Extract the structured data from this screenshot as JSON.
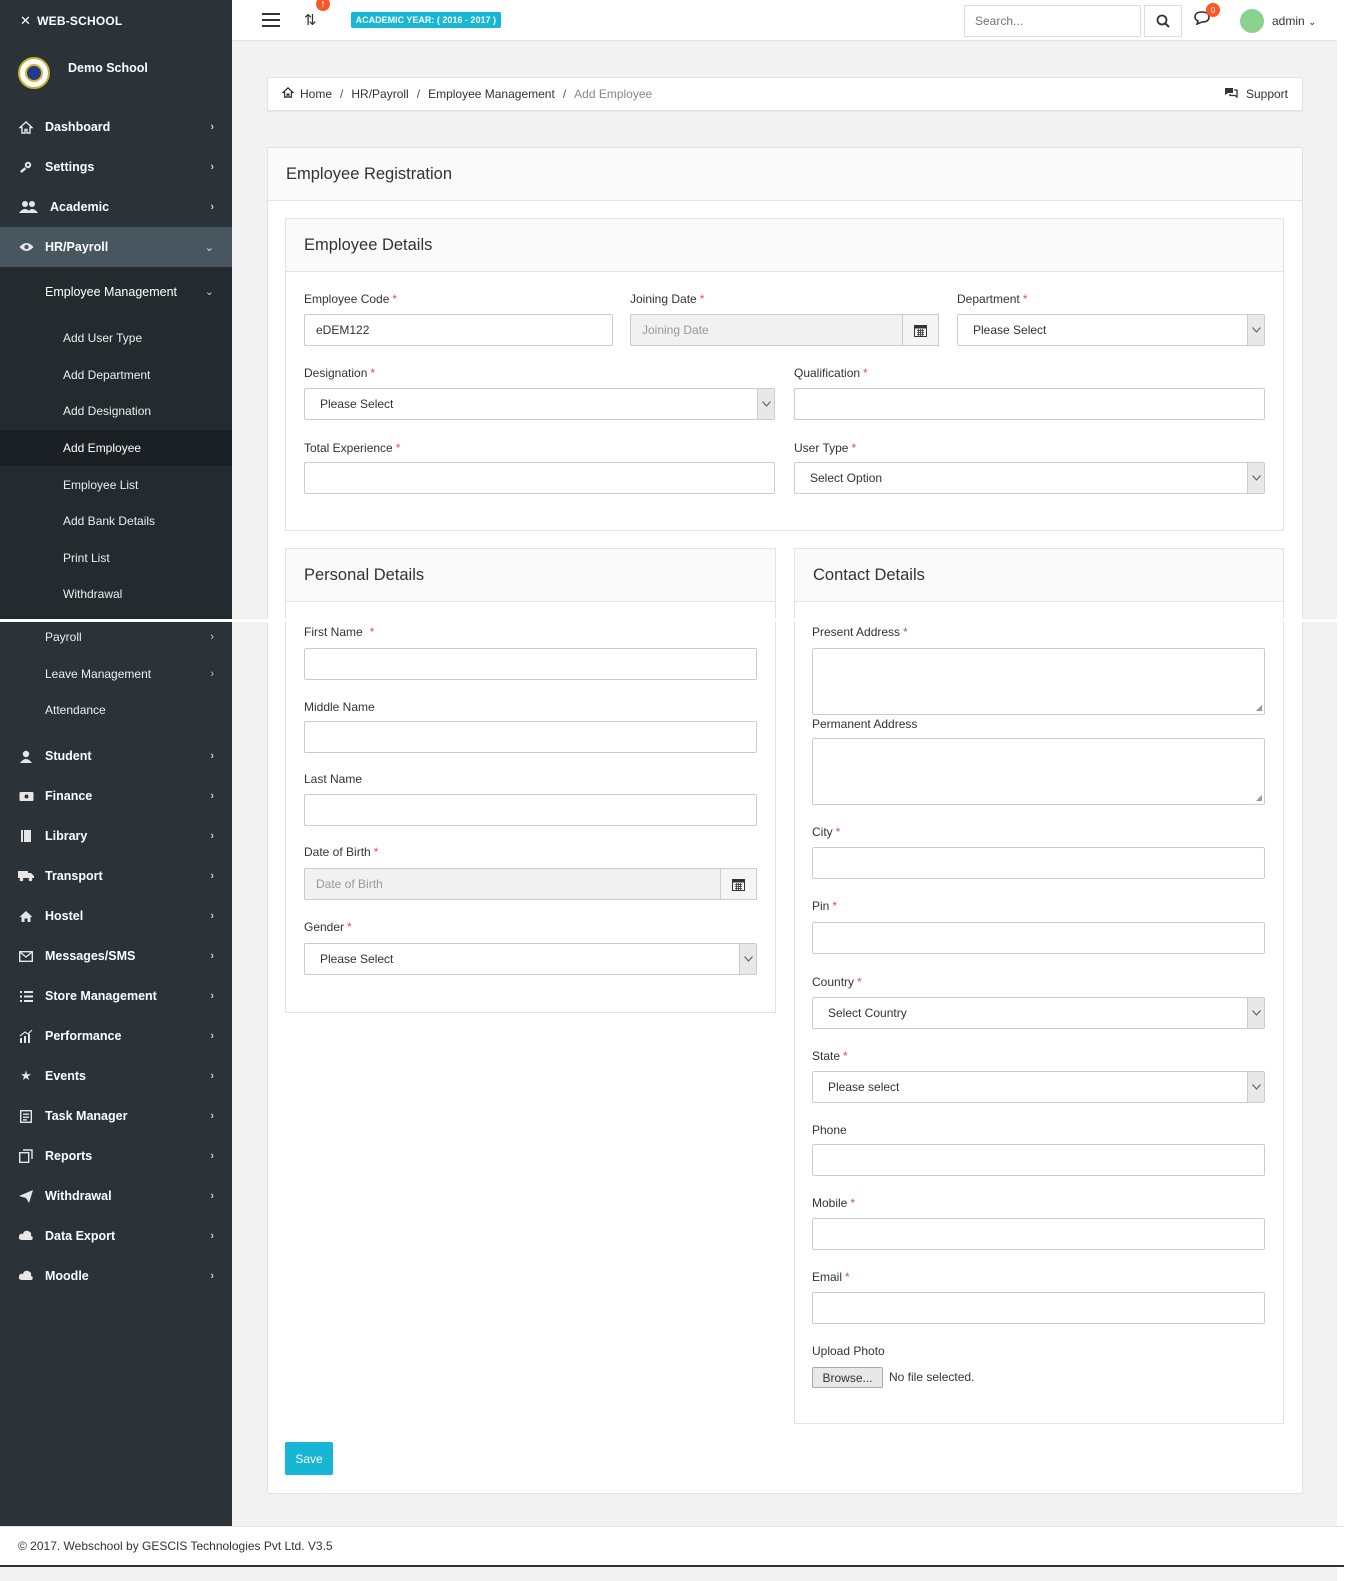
{
  "brand": "WEB-SCHOOL",
  "school_name": "Demo School",
  "sidebar": {
    "top_items": [
      {
        "label": "Dashboard",
        "icon": "home-icon"
      },
      {
        "label": "Settings",
        "icon": "settings-icon"
      },
      {
        "label": "Academic",
        "icon": "users-icon"
      },
      {
        "label": "HR/Payroll",
        "icon": "eye-icon"
      }
    ],
    "submenu_title": "Employee Management",
    "submenu_items": [
      "Add User Type",
      "Add Department",
      "Add Designation",
      "Add Employee",
      "Employee List",
      "Add Bank Details",
      "Print List",
      "Withdrawal"
    ],
    "hr_items": [
      "Payroll",
      "Leave Management",
      "Attendance"
    ],
    "bottom_items": [
      {
        "label": "Student",
        "icon": "user-icon"
      },
      {
        "label": "Finance",
        "icon": "bank-icon"
      },
      {
        "label": "Library",
        "icon": "book-icon"
      },
      {
        "label": "Transport",
        "icon": "truck-icon"
      },
      {
        "label": "Hostel",
        "icon": "home-icon"
      },
      {
        "label": "Messages/SMS",
        "icon": "envelope-icon"
      },
      {
        "label": "Store Management",
        "icon": "list-icon"
      },
      {
        "label": "Performance",
        "icon": "chart-icon"
      },
      {
        "label": "Events",
        "icon": "star-icon"
      },
      {
        "label": "Task Manager",
        "icon": "task-icon"
      },
      {
        "label": "Reports",
        "icon": "reports-icon"
      },
      {
        "label": "Withdrawal",
        "icon": "send-icon"
      },
      {
        "label": "Data Export",
        "icon": "cloud-icon"
      },
      {
        "label": "Moodle",
        "icon": "cloud-icon"
      }
    ]
  },
  "topbar": {
    "sync_badge": "!",
    "academic_year": "ACADEMIC YEAR: ( 2016 - 2017 )",
    "search_placeholder": "Search...",
    "chat_badge": "0",
    "user": "admin"
  },
  "breadcrumb": {
    "items": [
      "Home",
      "HR/Payroll",
      "Employee Management"
    ],
    "current": "Add Employee",
    "support": "Support"
  },
  "form": {
    "title": "Employee Registration",
    "employee_details": {
      "title": "Employee Details",
      "employee_code_label": "Employee Code",
      "employee_code_value": "eDEM122",
      "joining_date_label": "Joining Date",
      "joining_date_placeholder": "Joining Date",
      "department_label": "Department",
      "department_value": "Please Select",
      "designation_label": "Designation",
      "designation_value": "Please Select",
      "qualification_label": "Qualification",
      "total_experience_label": "Total Experience",
      "user_type_label": "User Type",
      "user_type_value": "Select Option"
    },
    "personal_details": {
      "title": "Personal Details",
      "first_name_label": "First Name",
      "middle_name_label": "Middle Name",
      "last_name_label": "Last Name",
      "dob_label": "Date of Birth",
      "dob_placeholder": "Date of Birth",
      "gender_label": "Gender",
      "gender_value": "Please Select"
    },
    "contact_details": {
      "title": "Contact Details",
      "present_address_label": "Present Address",
      "permanent_address_label": "Permanent Address",
      "city_label": "City",
      "pin_label": "Pin",
      "country_label": "Country",
      "country_value": "Select Country",
      "state_label": "State",
      "state_value": "Please select",
      "phone_label": "Phone",
      "mobile_label": "Mobile",
      "email_label": "Email",
      "upload_photo_label": "Upload Photo",
      "browse_label": "Browse...",
      "no_file": "No file selected."
    },
    "save_label": "Save"
  },
  "footer": "© 2017. Webschool by GESCIS Technologies Pvt Ltd. V3.5"
}
